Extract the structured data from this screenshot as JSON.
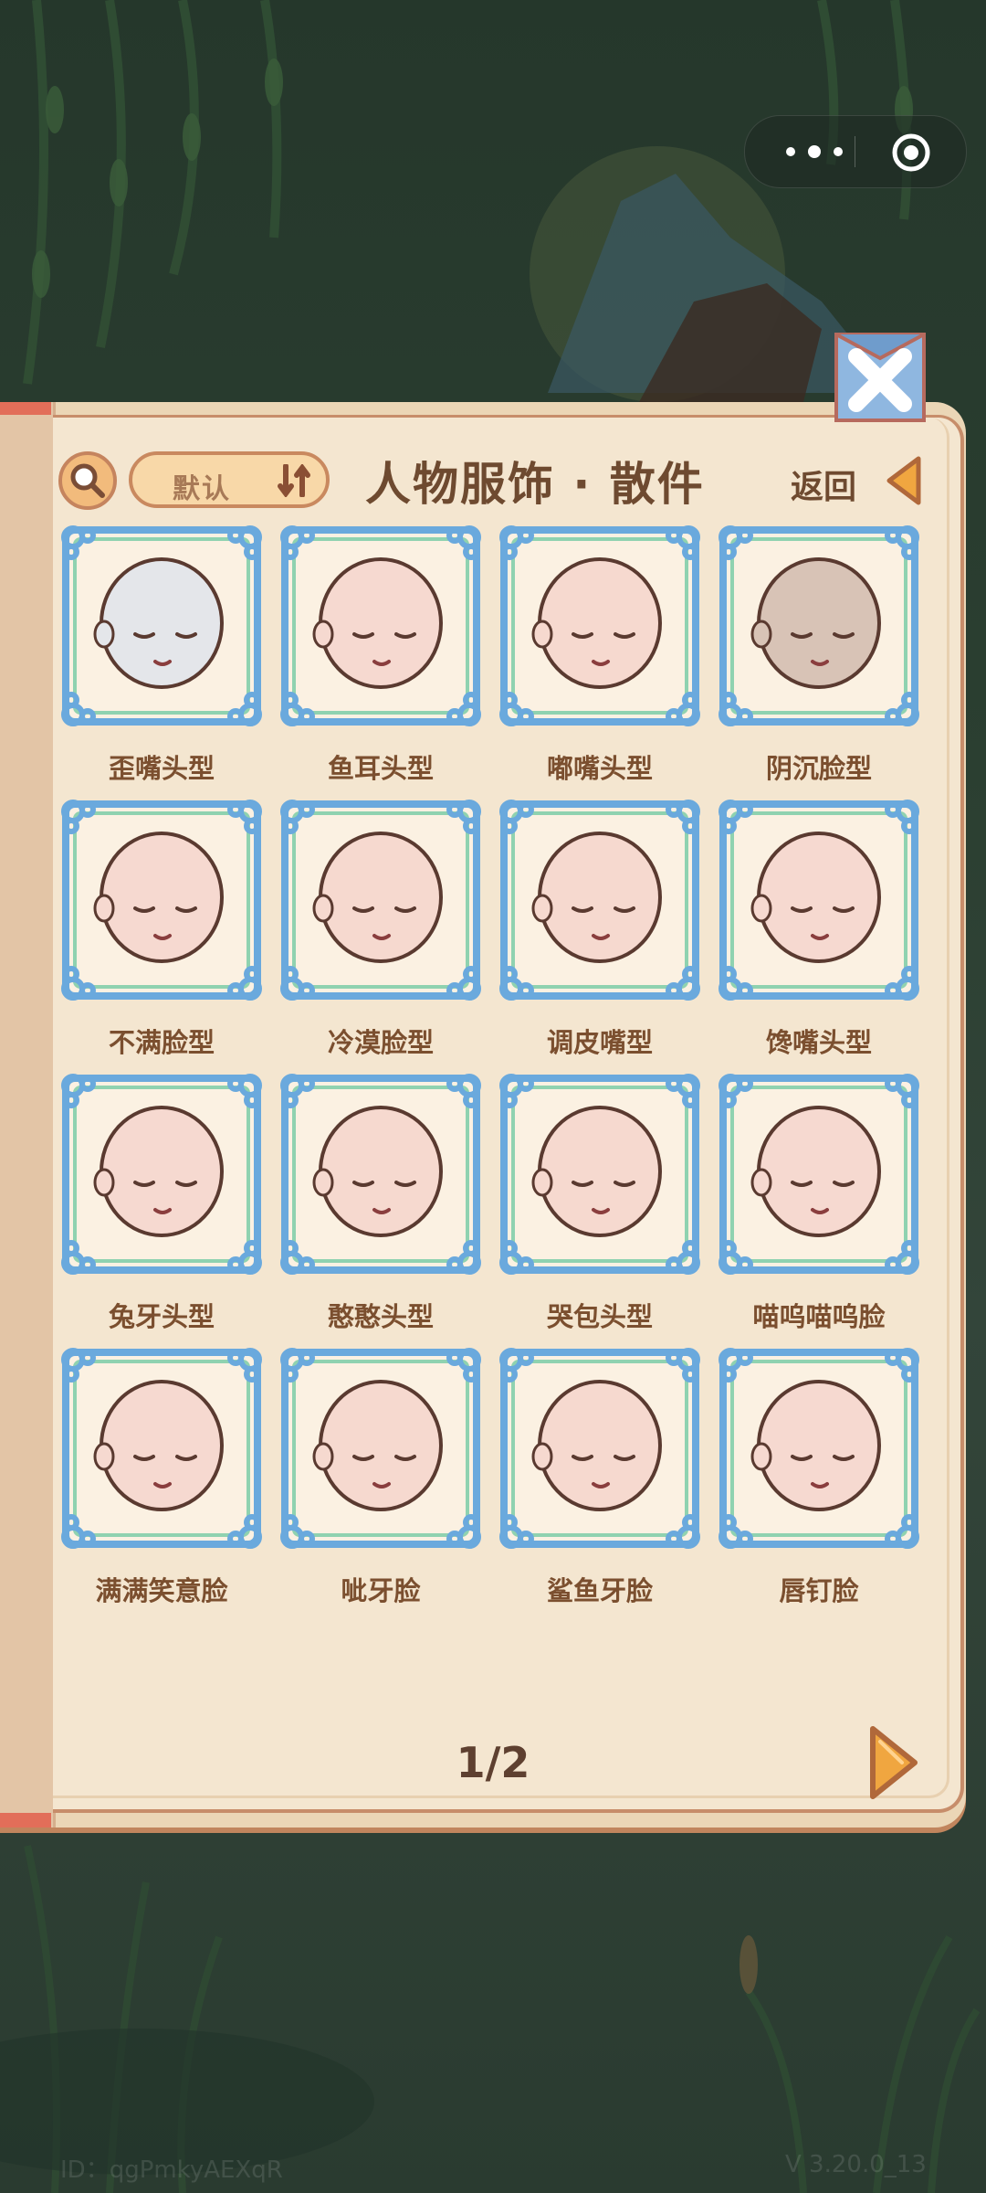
{
  "header": {
    "title": "人物服饰 · 散件",
    "sort_label": "默认",
    "back_label": "返回"
  },
  "items": [
    {
      "label": "歪嘴头型"
    },
    {
      "label": "鱼耳头型"
    },
    {
      "label": "嘟嘴头型"
    },
    {
      "label": "阴沉脸型"
    },
    {
      "label": "不满脸型"
    },
    {
      "label": "冷漠脸型"
    },
    {
      "label": "调皮嘴型"
    },
    {
      "label": "馋嘴头型"
    },
    {
      "label": "兔牙头型"
    },
    {
      "label": "憨憨头型"
    },
    {
      "label": "哭包头型"
    },
    {
      "label": "喵呜喵呜脸"
    },
    {
      "label": "满满笑意脸"
    },
    {
      "label": "呲牙脸"
    },
    {
      "label": "鲨鱼牙脸"
    },
    {
      "label": "唇钉脸"
    }
  ],
  "pagination": {
    "indicator": "1/2"
  },
  "footer": {
    "id": "ID：qgPmkyAEXqR",
    "version": "V 3.20.0_13"
  },
  "colors": {
    "panel_bg": "#f4e6d0",
    "frame_blue": "#6aa9dd",
    "frame_green": "#8fd2b0",
    "label_brown": "#7b4f2f",
    "accent_orange": "#e48f3d"
  }
}
